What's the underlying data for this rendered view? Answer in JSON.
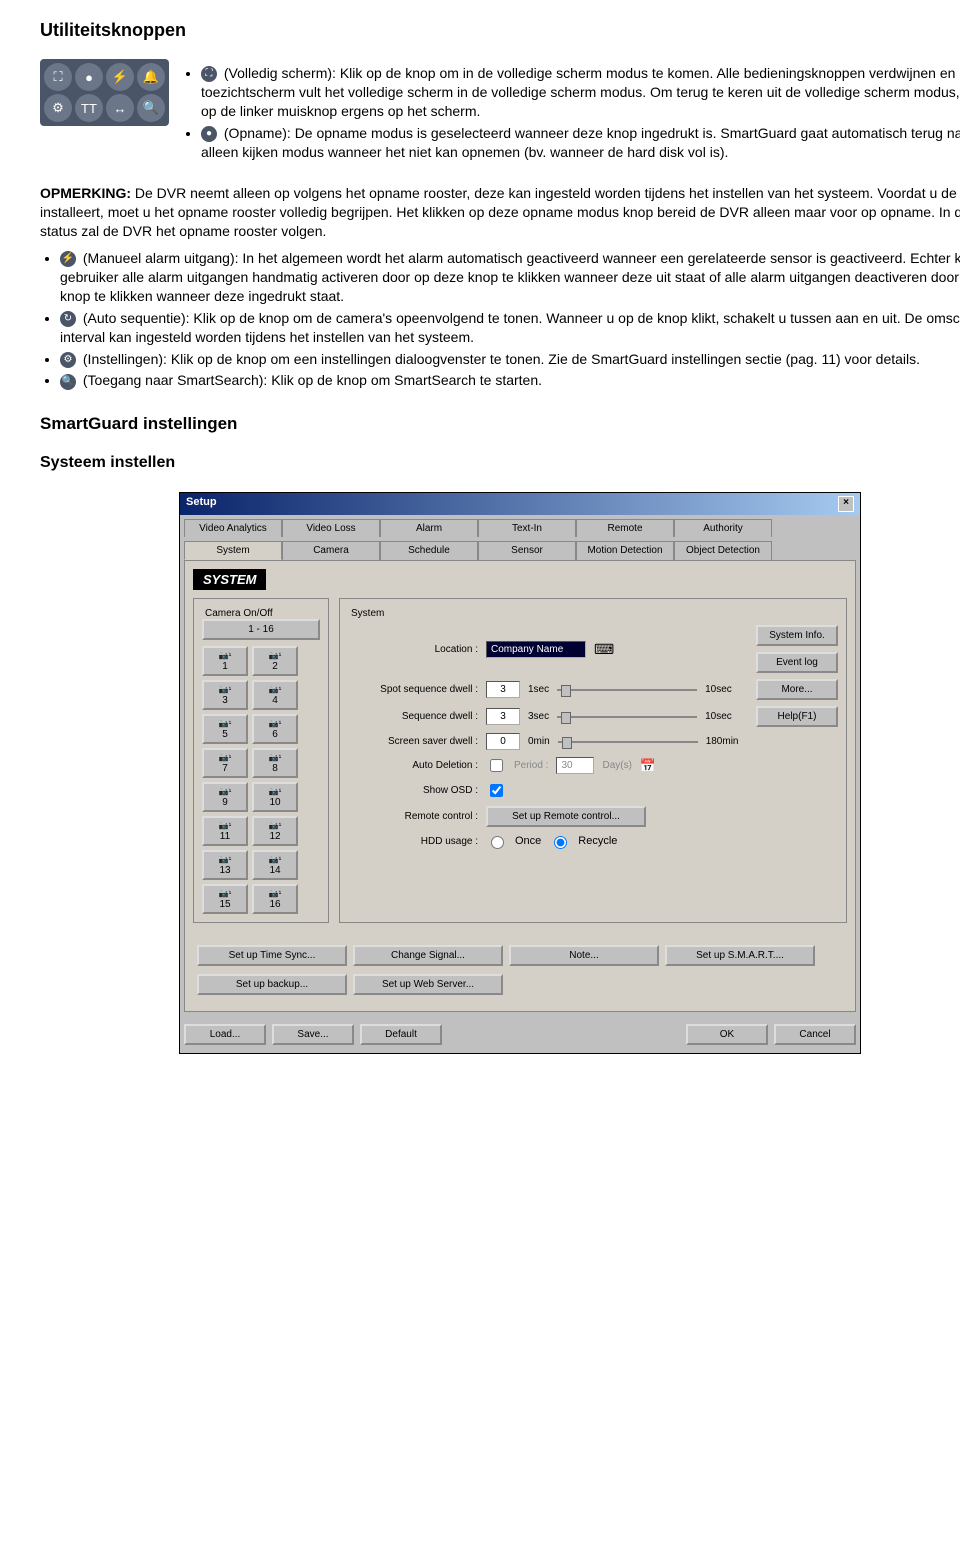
{
  "h1": "Utiliteitsknoppen",
  "intro_bullet1_prefix": "(Volledig scherm): Klik op de knop om in de volledige scherm modus te komen. Alle bedieningsknoppen verdwijnen en het toezichtscherm vult het volledige scherm in de volledige scherm modus. Om terug te keren uit de volledige scherm modus, klikt u op de linker muisknop ergens op het scherm.",
  "intro_bullet2": "(Opname): De opname modus is geselecteerd wanneer deze knop ingedrukt is. SmartGuard gaat automatisch terug naar de alleen kijken modus wanneer het niet kan opnemen (bv. wanneer de hard disk vol is).",
  "opm_label": "OPMERKING:",
  "opm_text": " De DVR neemt alleen op volgens het opname rooster, deze kan ingesteld worden tijdens het instellen van het systeem. Voordat u de DVR installeert, moet u het opname rooster volledig begrijpen. Het klikken op deze opname modus knop bereid de DVR alleen maar voor op opname. In deze status zal de DVR het opname rooster volgen.",
  "b_manual": "(Manueel alarm uitgang): In het algemeen wordt het alarm automatisch geactiveerd wanneer een gerelateerde sensor is geactiveerd. Echter kan de gebruiker alle alarm uitgangen handmatig activeren door op deze knop te klikken wanneer deze uit staat of alle alarm uitgangen deactiveren door op de knop te klikken wanneer deze ingedrukt staat.",
  "b_autoseq": "(Auto sequentie): Klik op de knop om de camera's opeenvolgend te tonen. Wanneer u op de knop klikt, schakelt u tussen aan en uit. De omschakel interval kan ingesteld worden tijdens het instellen van het systeem.",
  "b_settings1": "(Instellingen): Klik op de knop om een instellingen dialoogvenster te tonen. Zie de ",
  "b_settings_link": "SmartGuard instellingen",
  "b_settings2": " sectie (pag. 11) voor details.",
  "b_search": "(Toegang naar SmartSearch): Klik op de knop om SmartSearch te starten.",
  "h2": "SmartGuard instellingen",
  "h3": "Systeem instellen",
  "dlg": {
    "title": "Setup",
    "tabs_top": [
      "Video Analytics",
      "Video Loss",
      "Alarm",
      "Text-In",
      "Remote",
      "Authority"
    ],
    "tabs_bot": [
      "System",
      "Camera",
      "Schedule",
      "Sensor",
      "Motion Detection",
      "Object Detection"
    ],
    "sys_label": "SYSTEM",
    "camera_onoff": "Camera On/Off",
    "range": "1 - 16",
    "camlabels": [
      "1",
      "2",
      "3",
      "4",
      "5",
      "6",
      "7",
      "8",
      "9",
      "10",
      "11",
      "12",
      "13",
      "14",
      "15",
      "16"
    ],
    "system_label": "System",
    "loc_label": "Location :",
    "loc_value": "Company Name",
    "sysinfo": "System Info.",
    "eventlog": "Event log",
    "rows": [
      {
        "label": "Spot sequence dwell :",
        "val": "3",
        "left": "1sec",
        "right": "10sec",
        "btn": "More..."
      },
      {
        "label": "Sequence dwell :",
        "val": "3",
        "left": "3sec",
        "right": "10sec",
        "btn": "Help(F1)"
      },
      {
        "label": "Screen saver dwell :",
        "val": "0",
        "left": "0min",
        "right": "180min",
        "btn": ""
      }
    ],
    "autodel": "Auto Deletion :",
    "period_lbl": "Period :",
    "period_val": "30",
    "period_unit": "Day(s)",
    "showosd": "Show OSD :",
    "remote_lbl": "Remote control :",
    "remote_btn": "Set up Remote control...",
    "hdd_lbl": "HDD usage :",
    "hdd_once": "Once",
    "hdd_recycle": "Recycle",
    "btns1": [
      "Set up Time Sync...",
      "Change Signal...",
      "Note...",
      "Set up S.M.A.R.T...."
    ],
    "btns2": [
      "Set up backup...",
      "Set up Web Server..."
    ],
    "btns3": [
      "Load...",
      "Save...",
      "Default"
    ],
    "btns4": [
      "OK",
      "Cancel"
    ]
  },
  "page": "11"
}
